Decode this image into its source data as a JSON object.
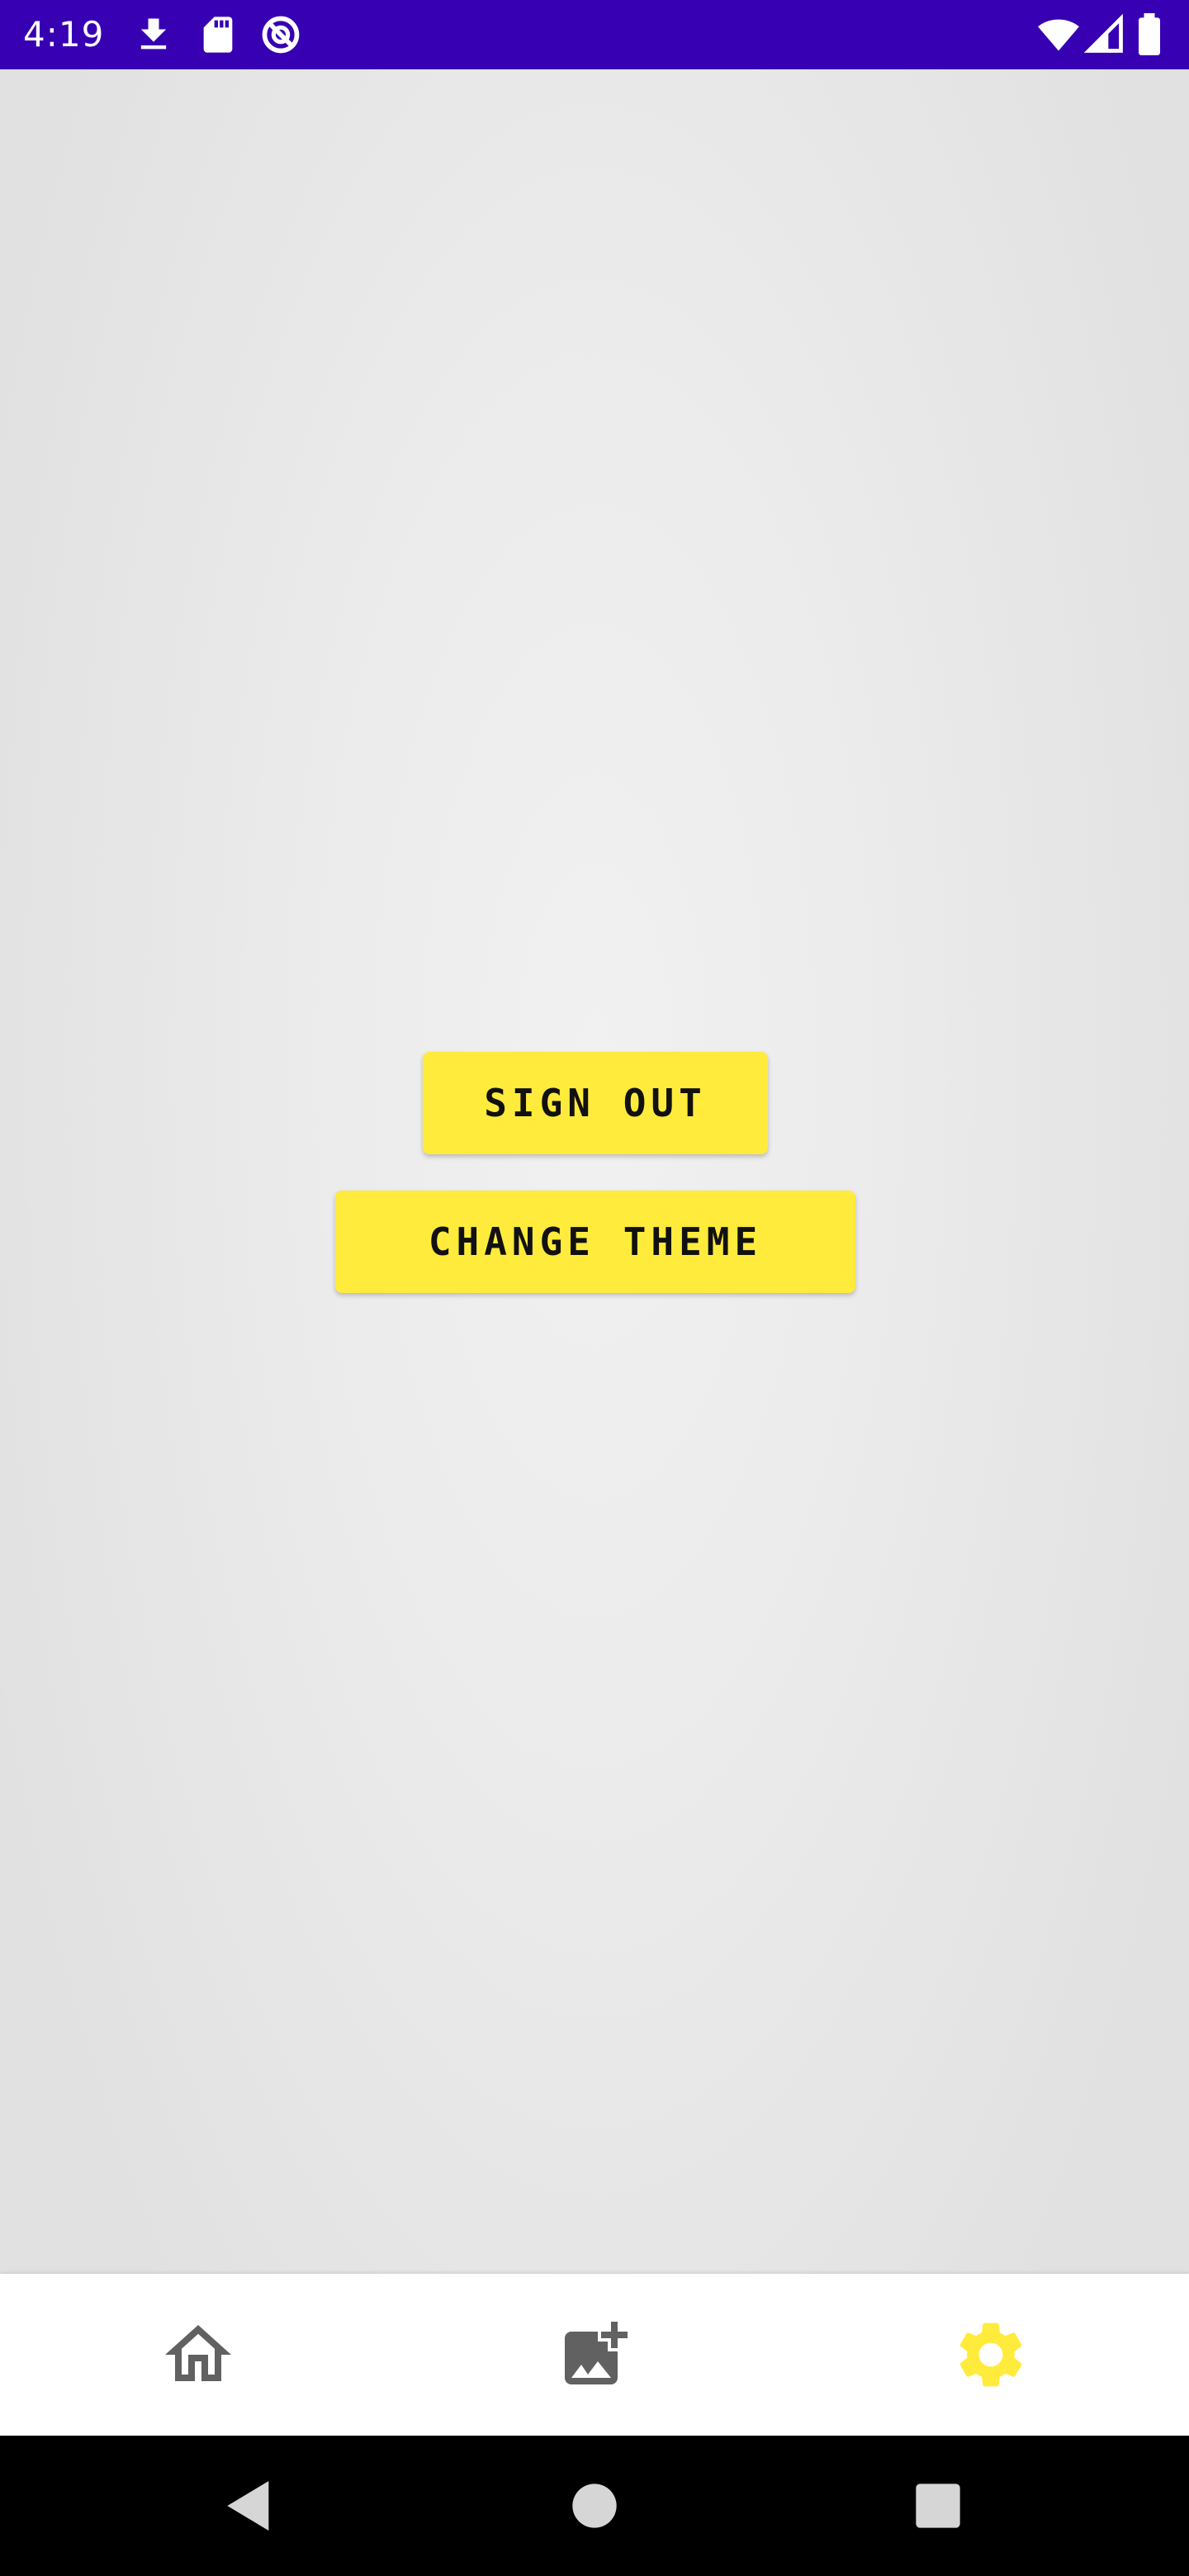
{
  "status_bar": {
    "time": "4:19",
    "background": "#3700b3",
    "left_icons": [
      "download-icon",
      "sd-card-icon",
      "no-disturb-icon"
    ],
    "right_icons": [
      "wifi-icon",
      "cellular-signal-icon",
      "battery-icon"
    ]
  },
  "main": {
    "background": "#e6e6e6",
    "buttons": {
      "sign_out_label": "SIGN OUT",
      "change_theme_label": "CHANGE THEME",
      "color": "#ffeb3b"
    }
  },
  "bottom_nav": {
    "items": [
      {
        "icon": "home-icon",
        "active": false
      },
      {
        "icon": "add-photo-icon",
        "active": false
      },
      {
        "icon": "settings-gear-icon",
        "active": true
      }
    ],
    "inactive_color": "#616161",
    "active_color": "#ffeb3b"
  },
  "system_nav": {
    "items": [
      "back-icon",
      "home-circle-icon",
      "recents-icon"
    ]
  }
}
